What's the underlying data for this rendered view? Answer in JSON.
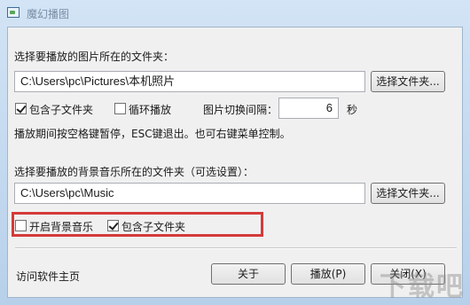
{
  "window": {
    "title": "魔幻播图",
    "icon": "app-icon"
  },
  "pictures": {
    "section_label": "选择要播放的图片所在的文件夹：",
    "folder_value": "C:\\Users\\pc\\Pictures\\本机照片",
    "browse_label": "选择文件夹...",
    "include_subfolders": {
      "label": "包含子文件夹",
      "checked": true
    },
    "loop": {
      "label": "循环播放",
      "checked": false
    },
    "interval_label": "图片切换间隔：",
    "interval_value": "6",
    "interval_unit": "秒",
    "hint": "播放期间按空格键暂停，ESC键退出。也可右键菜单控制。"
  },
  "music": {
    "section_label": "选择要播放的背景音乐所在的文件夹（可选设置）：",
    "folder_value": "C:\\Users\\pc\\Music",
    "browse_label": "选择文件夹...",
    "enable_music": {
      "label": "开启背景音乐",
      "checked": false
    },
    "include_subfolders": {
      "label": "包含子文件夹",
      "checked": true
    }
  },
  "footer": {
    "homepage_link": "访问软件主页",
    "about_label": "关于",
    "play_label": "播放(P)",
    "close_label": "关闭(X)"
  },
  "watermark": {
    "text": "下载吧"
  },
  "colors": {
    "highlight": "#d43a3a",
    "titlebar": "#c9ddf1"
  }
}
